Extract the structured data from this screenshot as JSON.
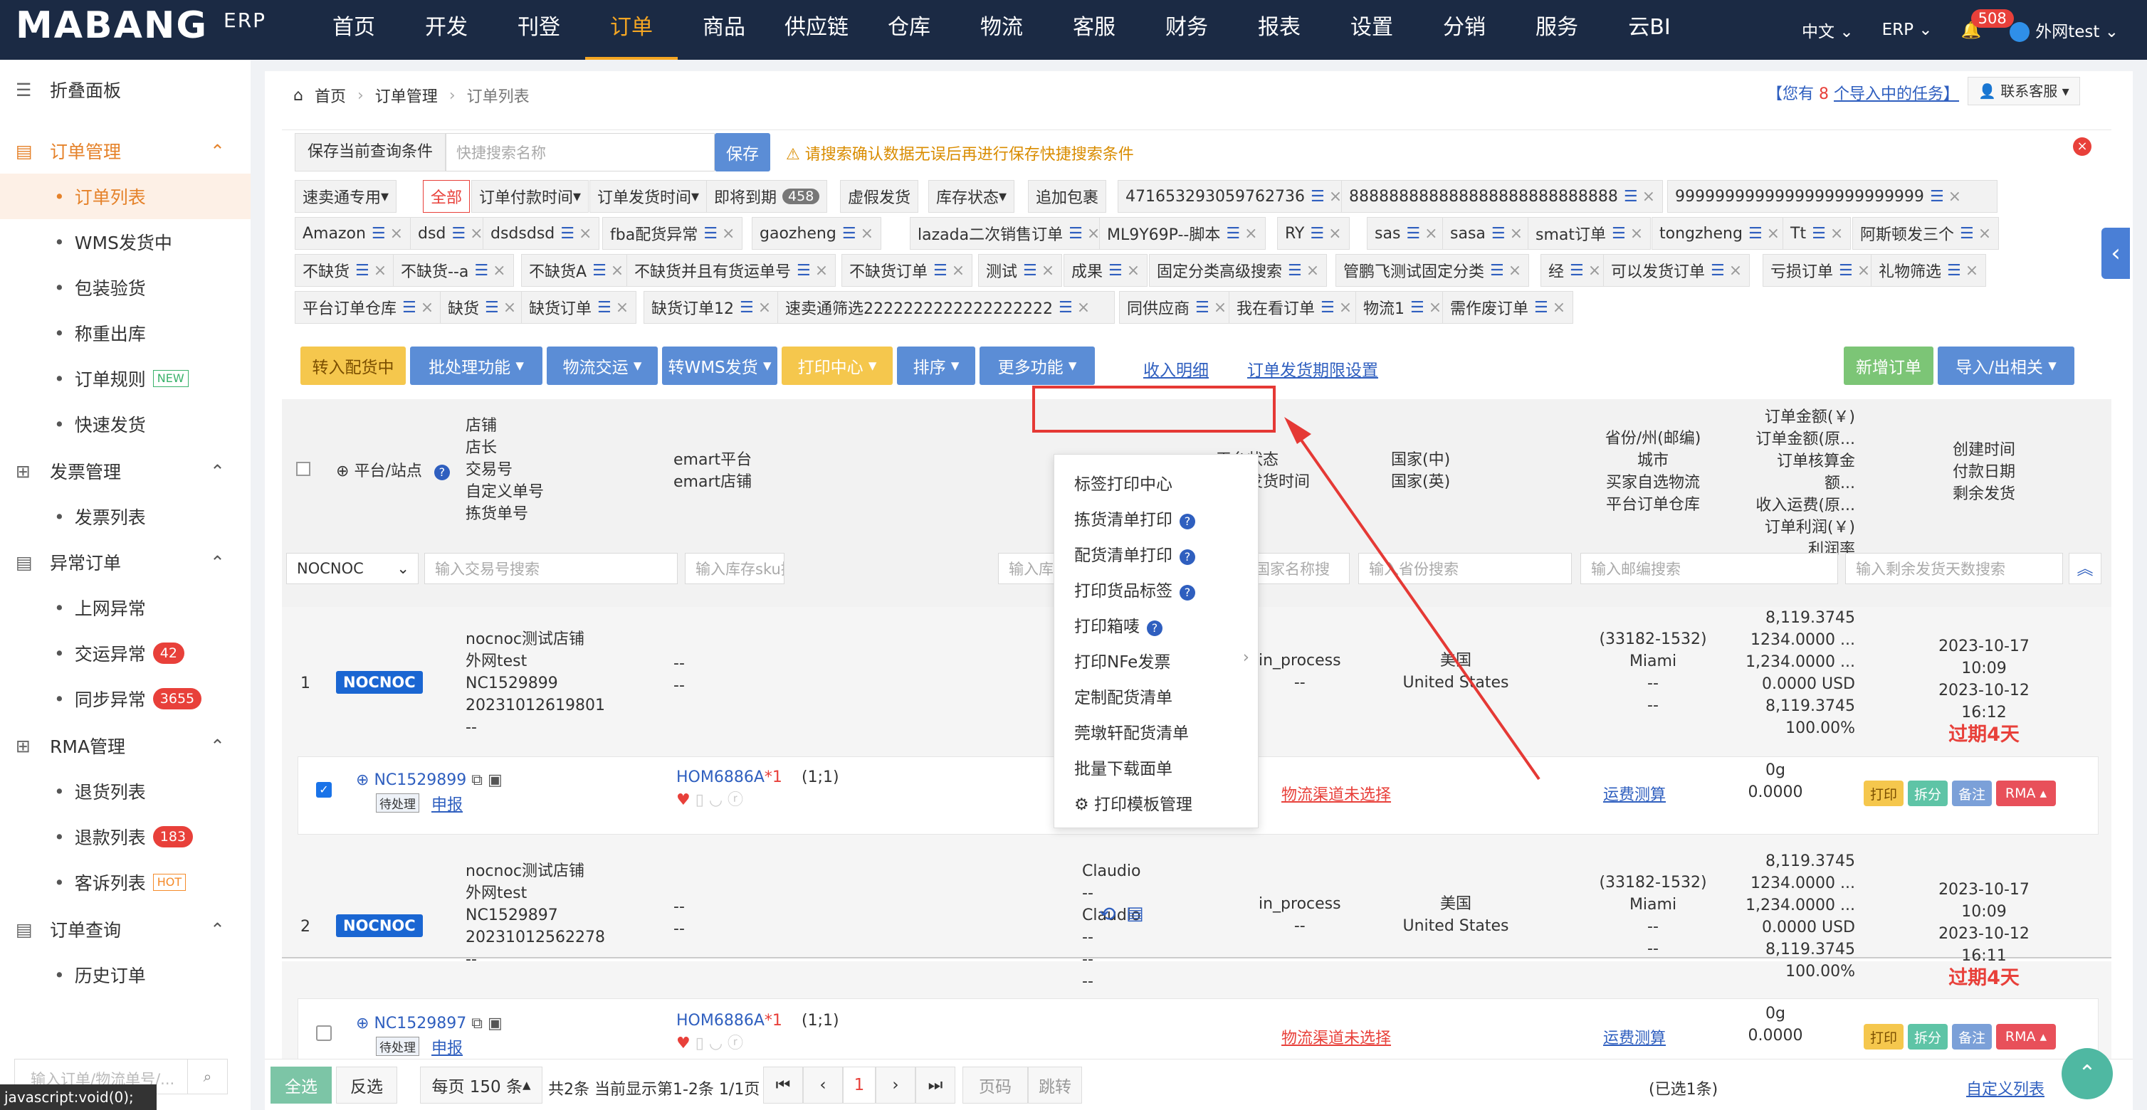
{
  "header": {
    "logo": "MABANG",
    "logo_sub": "ERP",
    "nav": [
      "首页",
      "开发",
      "刊登",
      "订单",
      "商品",
      "供应链",
      "仓库",
      "物流",
      "客服",
      "财务",
      "报表",
      "设置",
      "分销",
      "服务",
      "云BI"
    ],
    "active_nav": "订单",
    "lang": "中文",
    "erp": "ERP",
    "notif_count": "508",
    "user": "外网test"
  },
  "sidebar": {
    "collapse": "折叠面板",
    "groups": [
      {
        "label": "订单管理",
        "items": [
          "订单列表",
          "WMS发货中",
          "包装验货",
          "称重出库",
          "订单规则",
          "快速发货"
        ]
      },
      {
        "label": "发票管理",
        "items": [
          "发票列表"
        ]
      },
      {
        "label": "异常订单",
        "items": [
          "上网异常",
          "交运异常",
          "同步异常"
        ]
      },
      {
        "label": "RMA管理",
        "items": [
          "退货列表",
          "退款列表",
          "客诉列表"
        ]
      },
      {
        "label": "订单查询",
        "items": [
          "历史订单"
        ]
      }
    ],
    "tag_new": "NEW",
    "tag_hot": "HOT",
    "count_jiaoyun": "42",
    "count_tongbu": "3655",
    "count_tuikuan": "183",
    "search_placeholder": "输入订单/物流单号/..."
  },
  "breadcrumb": {
    "home": "首页",
    "level1": "订单管理",
    "level2": "订单列表"
  },
  "task_notice": {
    "prefix": "【您有",
    "count": "8",
    "suffix": "个导入中的任务】",
    "service": "联系客服"
  },
  "search": {
    "save_condition": "保存当前查询条件",
    "placeholder": "快捷搜索名称",
    "save_btn": "保存",
    "warning": "请搜索确认数据无误后再进行保存快捷搜索条件"
  },
  "chips_row1": [
    "速卖通专用",
    "全部",
    "订单付款时间",
    "订单发货时间",
    "即将到期",
    "虚假发货",
    "库存状态",
    "追加包裹",
    "471653293059762736",
    "888888888888888888888888888",
    "9999999999999999999999999"
  ],
  "expiring_count": "458",
  "chips_row2": [
    "Amazon",
    "dsd",
    "dsdsdsd",
    "fba配货异常",
    "gaozheng",
    "lazada二次销售订单",
    "ML9Y69P--脚本",
    "RY",
    "sas",
    "sasa",
    "smat订单",
    "tongzheng",
    "Tt",
    "阿斯顿发三个"
  ],
  "chips_row3": [
    "不缺货",
    "不缺货--a",
    "不缺货A",
    "不缺货并且有货运单号",
    "不缺货订单",
    "测试",
    "成果",
    "固定分类高级搜索",
    "管鹏飞测试固定分类",
    "经",
    "可以发货订单",
    "亏损订单",
    "礼物筛选"
  ],
  "chips_row4": [
    "平台订单仓库",
    "缺货",
    "缺货订单",
    "缺货订单12",
    "速卖通筛选2222222222222222222",
    "同供应商",
    "我在看订单",
    "物流1",
    "需作废订单"
  ],
  "toolbar": {
    "to_stock": "转入配货中",
    "batch": "批处理功能",
    "logistics": "物流交运",
    "to_wms": "转WMS发货",
    "print_center": "打印中心",
    "sort": "排序",
    "more": "更多功能",
    "income_detail": "收入明细",
    "ship_limit": "订单发货期限设置",
    "new_order": "新增订单",
    "import_export": "导入/出相关"
  },
  "print_menu": [
    "标签打印中心",
    "拣货清单打印",
    "配货清单打印",
    "打印货品标签",
    "打印箱唛",
    "打印NFe发票",
    "定制配货清单",
    "莞墩轩配货清单",
    "批量下载面单",
    "打印模板管理"
  ],
  "table_headers": {
    "platform": "平台/站点",
    "shop_block": [
      "店铺",
      "店长",
      "交易号",
      "自定义单号",
      "拣货单号"
    ],
    "emart": [
      "emart平台",
      "emart店铺"
    ],
    "platform_status": [
      "平台状态",
      "真实发货时间"
    ],
    "country": [
      "国家(中)",
      "国家(英)"
    ],
    "province": [
      "省份/州(邮编)",
      "城市",
      "买家自选物流",
      "平台订单仓库"
    ],
    "amount": [
      "订单金额(￥)",
      "订单金额(原...",
      "订单核算金额...",
      "收入运费(原...",
      "订单利润(￥)",
      "利润率"
    ],
    "time": [
      "创建时间",
      "付款日期",
      "剩余发货"
    ]
  },
  "filters": {
    "platform": "NOCNOC",
    "trade": "输入交易号搜索",
    "sku": "输入库存sku搜索",
    "sku_name": "输入库存sku名称搜索",
    "country": "输入国家名称搜",
    "province": "输入省份搜索",
    "zip": "输入邮编搜索",
    "remain": "输入剩余发货天数搜索"
  },
  "orders": [
    {
      "idx": "1",
      "platform": "NOCNOC",
      "shop": "nocnoc测试店铺",
      "manager": "外网test",
      "trade": "NC1529899",
      "custom": "20231012619801",
      "pick": "--",
      "emart": [
        "--",
        "--"
      ],
      "status": "in_process",
      "ship": "--",
      "country_cn": "美国",
      "country_en": "United States",
      "zip": "(33182-1532)",
      "city": "Miami",
      "buyer": "--",
      "warehouse": "--",
      "amounts": [
        "8,119.3745",
        "1234.0000 ...",
        "1,234.0000 ...",
        "0.0000 USD",
        "8,119.3745",
        "100.00%"
      ],
      "created": "2023-10-17 10:09",
      "paid": "2023-10-12 16:12",
      "remain": "过期4天",
      "order_no": "NC1529899",
      "pending": "待处理",
      "declare": "申报",
      "sku": "HOM6886A",
      "qty": "1",
      "qty_detail": "(1;1)",
      "logistics": "物流渠道未选择",
      "freight": "运费测算",
      "weight": "0g",
      "weight_val": "0.0000"
    },
    {
      "idx": "2",
      "platform": "NOCNOC",
      "shop": "nocnoc测试店铺",
      "manager": "外网test",
      "trade": "NC1529897",
      "custom": "20231012562278",
      "pick": "--",
      "emart": [
        "--",
        "--"
      ],
      "buyer_block": [
        "Claudio",
        "--",
        "Claudio",
        "--",
        "--",
        "--"
      ],
      "status": "in_process",
      "ship": "--",
      "country_cn": "美国",
      "country_en": "United States",
      "zip": "(33182-1532)",
      "city": "Miami",
      "buyer": "--",
      "warehouse": "--",
      "amounts": [
        "8,119.3745",
        "1234.0000 ...",
        "1,234.0000 ...",
        "0.0000 USD",
        "8,119.3745",
        "100.00%"
      ],
      "created": "2023-10-17 10:09",
      "paid": "2023-10-12 16:11",
      "remain": "过期4天",
      "order_no": "NC1529897",
      "pending": "待处理",
      "declare": "申报",
      "sku": "HOM6886A",
      "qty": "1",
      "qty_detail": "(1;1)",
      "logistics": "物流渠道未选择",
      "freight": "运费测算",
      "weight": "0g",
      "weight_val": "0.0000"
    }
  ],
  "row_actions": {
    "print": "打印",
    "split": "拆分",
    "note": "备注",
    "rma": "RMA"
  },
  "footer": {
    "select_all": "全选",
    "invert": "反选",
    "per_page": "每页 150 条",
    "summary": "共2条 当前显示第1-2条 1/1页",
    "page": "1",
    "page_input": "页码",
    "jump": "跳转",
    "selected": "(已选1条)",
    "custom_list": "自定义列表",
    "status_url": "javascript:void(0);"
  },
  "colors": {
    "accent": "#f5a623",
    "nav_bg": "#1b2a44",
    "blue": "#5b8dd6",
    "annotation": "#e53935"
  }
}
